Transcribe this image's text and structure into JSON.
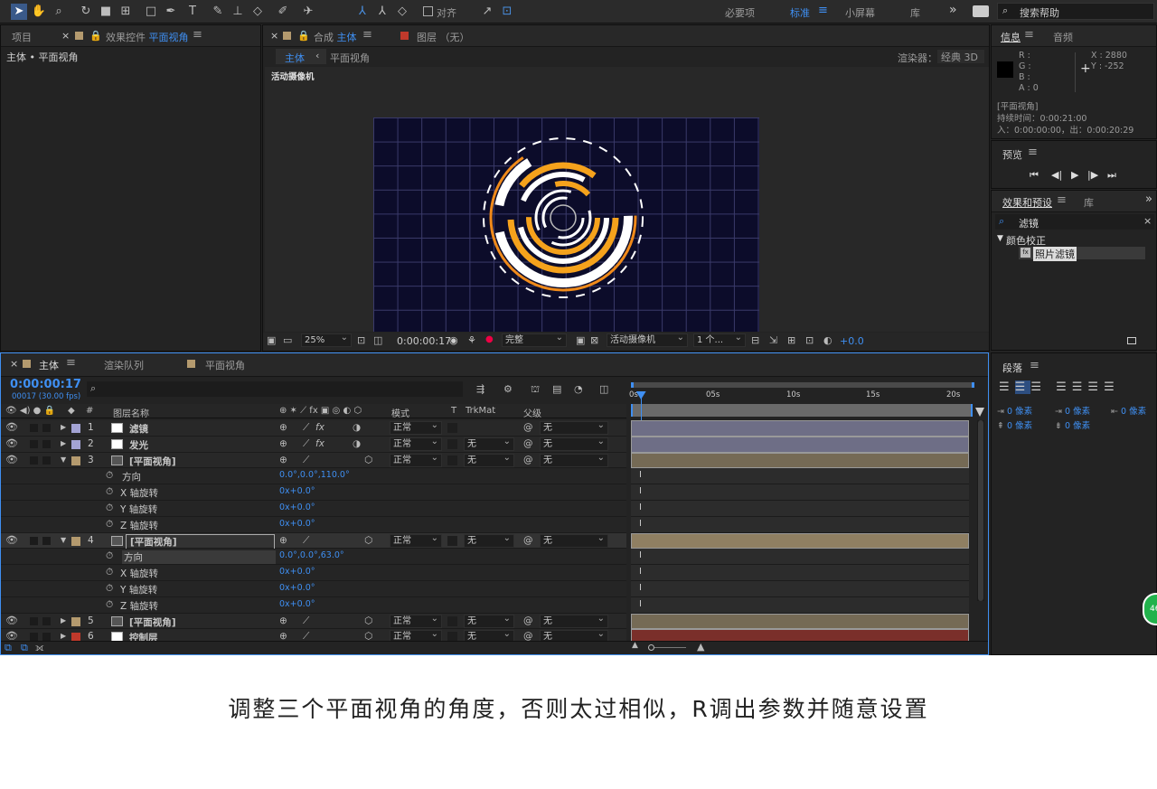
{
  "toolbar": {
    "snap_label": "对齐",
    "workspaces": [
      "必要项",
      "标准",
      "小屏幕",
      "库"
    ],
    "active_workspace": "标准",
    "search_placeholder": "搜索帮助"
  },
  "project_panel": {
    "tab_project": "项目",
    "tab_effects_prefix": "效果控件",
    "tab_effects_layer": "平面视角",
    "breadcrumb": "主体 • 平面视角"
  },
  "comp_panel": {
    "tab_comp_prefix": "合成",
    "tab_comp_name": "主体",
    "tab_layer": "图层 （无）",
    "nav_active": "主体",
    "nav_next": "平面视角",
    "renderer_label": "渲染器：",
    "renderer_value": "经典 3D",
    "camera_label": "活动摄像机",
    "zoom": "25%",
    "timecode": "0:00:00:17",
    "resolution": "完整",
    "camera_select": "活动摄像机",
    "views_select": "1 个...",
    "exposure": "+0.0"
  },
  "info_panel": {
    "tab_info": "信息",
    "tab_audio": "音频",
    "r": "R :",
    "g": "G :",
    "b": "B :",
    "a": "A : 0",
    "x": "X : 2880",
    "y": "Y : -252",
    "layer_name": "[平面视角]",
    "duration": "持续时间：0:00:21:00",
    "in_out": "入：0:00:00:00，出：0:00:20:29"
  },
  "preview_panel": {
    "title": "预览"
  },
  "effects_panel": {
    "tab_effects": "效果和预设",
    "tab_library": "库",
    "search_value": "滤镜",
    "category": "颜色校正",
    "effect_item": "照片滤镜"
  },
  "timeline": {
    "tab_main": "主体",
    "tab_render": "渲染队列",
    "tab_plane": "平面视角",
    "timecode": "0:00:00:17",
    "frames": "00017 (30.00 fps)",
    "col_num": "#",
    "col_name": "图层名称",
    "col_mode": "模式",
    "col_t": "T",
    "col_trkmat": "TrkMat",
    "col_parent": "父级",
    "ruler": [
      "0s",
      "05s",
      "10s",
      "15s",
      "20s"
    ],
    "playhead_fraction": 0.027,
    "rows": [
      {
        "num": "1",
        "name": "滤镜",
        "mode": "正常",
        "trkmat": "",
        "parent": "无",
        "type": "layer",
        "color": "#a3a3d4"
      },
      {
        "num": "2",
        "name": "发光",
        "mode": "正常",
        "trkmat": "无",
        "parent": "无",
        "type": "layer",
        "color": "#a3a3d4"
      },
      {
        "num": "3",
        "name": "[平面视角]",
        "mode": "正常",
        "trkmat": "无",
        "parent": "无",
        "type": "layer",
        "color": "#b49a6e"
      },
      {
        "name": "方向",
        "value": "0.0°,0.0°,110.0°",
        "type": "prop"
      },
      {
        "name": "X 轴旋转",
        "value": "0x+0.0°",
        "type": "prop"
      },
      {
        "name": "Y 轴旋转",
        "value": "0x+0.0°",
        "type": "prop"
      },
      {
        "name": "Z 轴旋转",
        "value": "0x+0.0°",
        "type": "prop"
      },
      {
        "num": "4",
        "name": "[平面视角]",
        "mode": "正常",
        "trkmat": "无",
        "parent": "无",
        "type": "layer",
        "color": "#b49a6e"
      },
      {
        "name": "方向",
        "value": "0.0°,0.0°,63.0°",
        "type": "prop"
      },
      {
        "name": "X 轴旋转",
        "value": "0x+0.0°",
        "type": "prop"
      },
      {
        "name": "Y 轴旋转",
        "value": "0x+0.0°",
        "type": "prop"
      },
      {
        "name": "Z 轴旋转",
        "value": "0x+0.0°",
        "type": "prop"
      },
      {
        "num": "5",
        "name": "[平面视角]",
        "mode": "正常",
        "trkmat": "无",
        "parent": "无",
        "type": "layer",
        "color": "#b49a6e"
      },
      {
        "num": "6",
        "name": "控制层",
        "mode": "正常",
        "trkmat": "无",
        "parent": "无",
        "type": "layer",
        "color": "#c0392b"
      }
    ]
  },
  "paragraph_panel": {
    "title": "段落",
    "indent_left": "0 像素",
    "indent_first": "0 像素",
    "indent_right": "0 像素",
    "space_before": "0 像素",
    "space_after": "0 像素"
  },
  "badge": "46",
  "caption": "调整三个平面视角的角度，否则太过相似，R调出参数并随意设置"
}
